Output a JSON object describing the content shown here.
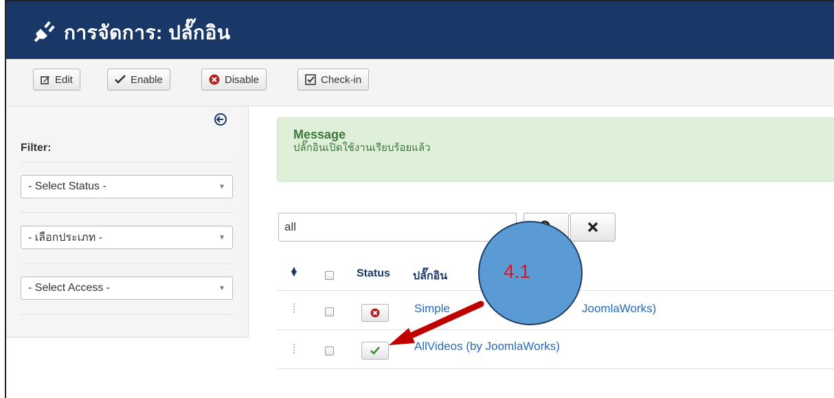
{
  "header": {
    "title": "การจัดการ: ปลั๊กอิน",
    "bg": "#1a3867"
  },
  "toolbar": {
    "edit_label": "Edit",
    "enable_label": "Enable",
    "disable_label": "Disable",
    "checkin_label": "Check-in"
  },
  "sidebar": {
    "filter_label": "Filter:",
    "filters": [
      {
        "selected": "- Select Status -"
      },
      {
        "selected": "- เลือกประเภท -"
      },
      {
        "selected": "- Select Access -"
      }
    ]
  },
  "message": {
    "title": "Message",
    "body": "ปลั๊กอินเปิดใช้งานเรียบร้อยแล้ว",
    "bg": "#dff0d8"
  },
  "search": {
    "value": "all"
  },
  "table": {
    "columns": {
      "status": "Status",
      "name": "ปลั๊กอิน"
    },
    "rows": [
      {
        "name": "Simple Image Gallery (by JoomlaWorks)",
        "visible_left": "Simple",
        "visible_right": "JoomlaWorks)",
        "status": "disabled"
      },
      {
        "name": "AllVideos (by JoomlaWorks)",
        "status": "enabled"
      }
    ]
  },
  "annotation": {
    "label": "4.1",
    "circle_color": "#5b9bd5",
    "arrow_color": "#c00000"
  }
}
